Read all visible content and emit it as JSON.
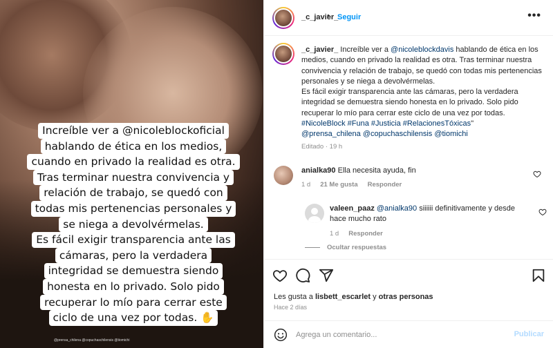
{
  "story_image": {
    "caption_lines": [
      "Increíble ver a @nicoleblockoficial",
      "hablando de ética en los medios,",
      "cuando en privado la realidad es otra.",
      "Tras terminar nuestra convivencia y",
      "relación de trabajo, se quedó con",
      "todas mis pertenencias personales y",
      "se niega a devolvérmelas.",
      "Es fácil exigir transparencia ante las",
      "cámaras, pero la verdadera",
      "integridad se demuestra siendo",
      "honesta en lo privado. Solo pido",
      "recuperar lo mío para cerrar este",
      "ciclo de una vez por todas. ✋"
    ],
    "small_tags": "@prensa_chilena @copuchaschilensis @tiomichi"
  },
  "header": {
    "username": "_c_javier_",
    "separator": "•",
    "follow_label": "Seguir",
    "more_icon": "more-horizontal-icon"
  },
  "post_caption": {
    "username": "_c_javier_",
    "text_before_mention": " Increíble ver a ",
    "mention": "@nicoleblockdavis",
    "text_after_mention": " hablando de ética en los medios, cuando en privado la realidad es otra. Tras terminar nuestra convivencia y relación de trabajo, se quedó con todas mis pertenencias personales y se niega a devolvérmelas.",
    "text_paragraph_2": "Es fácil exigir transparencia ante las cámaras, pero la verdadera integridad se demuestra siendo honesta en lo privado. Solo pido recuperar lo mío para cerrar este ciclo de una vez por todas.",
    "hashtags": "#NicoleBlock #Funa #Justicia #RelacionesTóxicas",
    "hashtag_tail": "\"",
    "mentions_line": "@prensa_chilena @copuchaschilensis @tiomichi",
    "meta": "Editado · 19 h"
  },
  "comments": [
    {
      "username": "anialka90",
      "text": "Ella necesita ayuda, fin",
      "time": "1 d",
      "likes": "21 Me gusta",
      "reply_label": "Responder"
    }
  ],
  "reply": {
    "username": "valeen_paaz",
    "mention": "@anialka90",
    "text": " siiiiii definitivamente y desde hace mucho rato",
    "time": "1 d",
    "reply_label": "Responder",
    "hide_replies_label": "Ocultar respuestas"
  },
  "actions": {
    "icons": [
      "heart-icon",
      "comment-icon",
      "share-icon",
      "bookmark-icon"
    ],
    "likes_prefix": "Les gusta a ",
    "likes_user": "lisbett_escarlet",
    "likes_mid": " y ",
    "likes_others": "otras personas",
    "posted_when": "Hace 2 días"
  },
  "composer": {
    "placeholder": "Agrega un comentario...",
    "publish_label": "Publicar"
  },
  "colors": {
    "link": "#00376b",
    "follow": "#0095f6",
    "muted": "#8e8e8e",
    "publish_disabled": "#b3dbff"
  }
}
